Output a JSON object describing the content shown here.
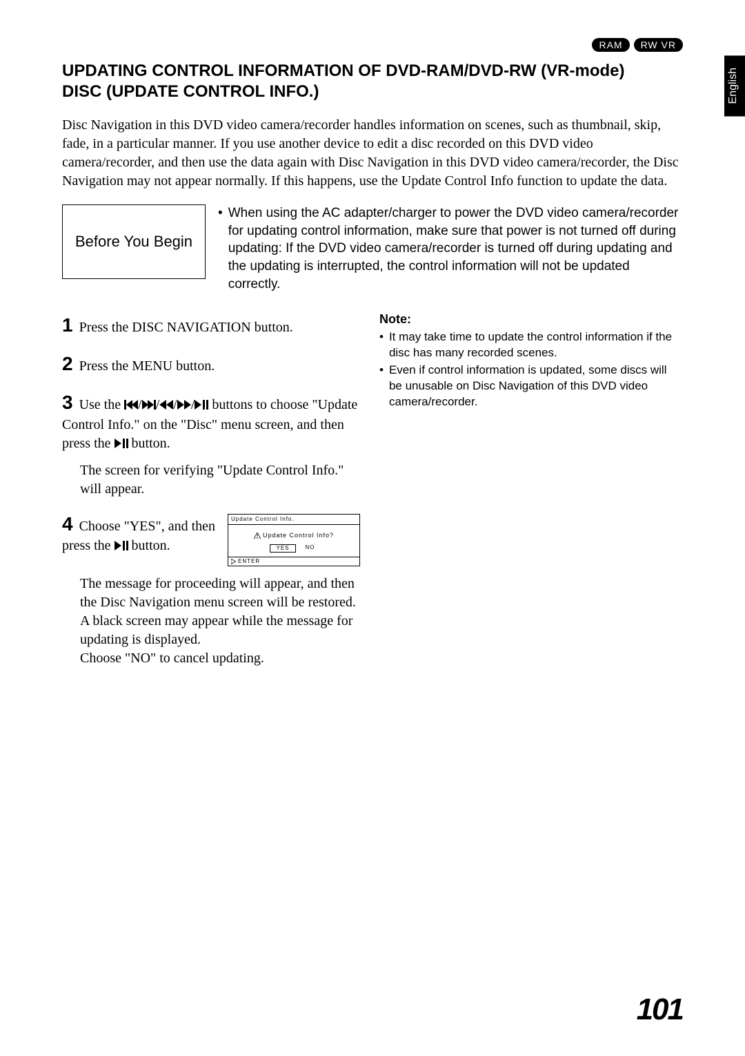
{
  "badges": {
    "ram": "RAM",
    "rwvr": "RW VR"
  },
  "side_tab": "English",
  "title": "UPDATING CONTROL INFORMATION OF DVD-RAM/DVD-RW (VR-mode) DISC (UPDATE CONTROL INFO.)",
  "intro": "Disc Navigation in this DVD video camera/recorder handles information on scenes, such as thumbnail, skip, fade, in a particular manner. If you use another device to edit a disc recorded on this DVD video camera/recorder, and then use the data again with Disc Navigation in this DVD video camera/recorder, the Disc Navigation may not appear normally. If this happens, use the Update Control Info function to update the data.",
  "before_box": "Before You Begin",
  "before_bullet": "When using the AC adapter/charger to power the DVD video camera/recorder for updating control information, make sure that power is not turned off during updating: If the DVD video camera/recorder is turned off during updating and the updating is interrupted, the control information will not be updated correctly.",
  "steps": {
    "s1": "Press the DISC NAVIGATION button.",
    "s2": "Press the MENU button.",
    "s3_a": "Use the ",
    "s3_b": " buttons to choose \"Update Control Info.\" on the \"Disc\" menu screen, and then press the ",
    "s3_c": " button.",
    "s3_sub": "The screen for verifying \"Update Control Info.\" will appear.",
    "s4_a": "Choose \"YES\", and then press the ",
    "s4_b": " button.",
    "s4_sub": "The message for proceeding will appear, and then the Disc Navigation menu screen will be restored.\nA black screen may appear while the message for updating is displayed.\nChoose \"NO\" to cancel updating."
  },
  "screen": {
    "title": "Update Control Info.",
    "question": "Update Control Info?",
    "yes": "YES",
    "no": "NO",
    "enter": "ENTER"
  },
  "note": {
    "head": "Note:",
    "n1": "It may take time to update the control information if the disc has many recorded scenes.",
    "n2": "Even if control information is updated, some discs will be unusable on Disc Navigation of this DVD video camera/recorder."
  },
  "page_number": "101"
}
